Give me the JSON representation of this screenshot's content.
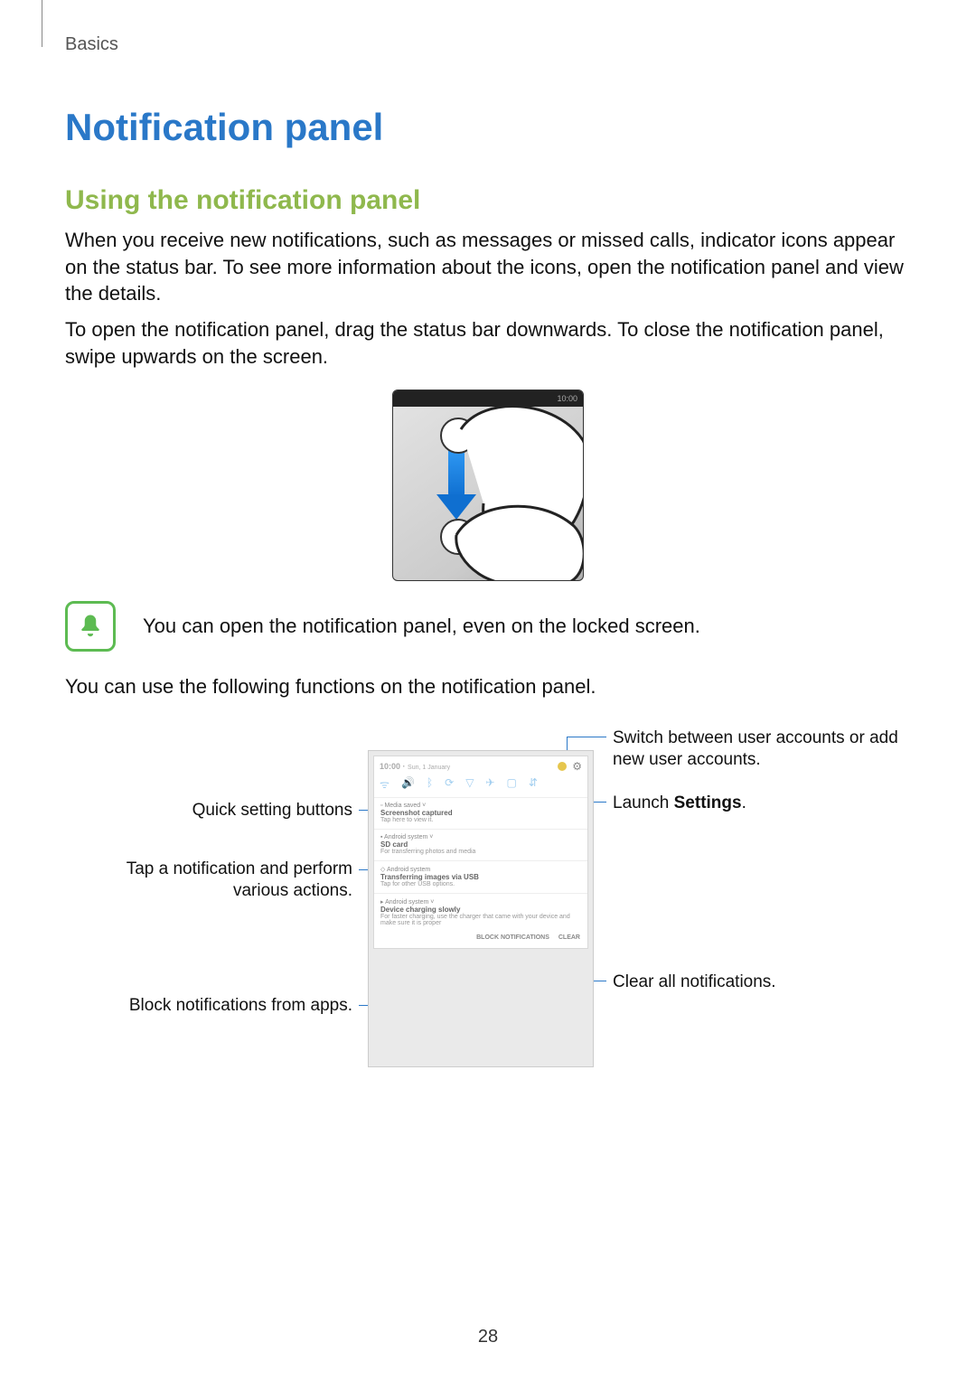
{
  "section": "Basics",
  "title": "Notification panel",
  "subtitle": "Using the notification panel",
  "para1": "When you receive new notifications, such as messages or missed calls, indicator icons appear on the status bar. To see more information about the icons, open the notification panel and view the details.",
  "para2": "To open the notification panel, drag the status bar downwards. To close the notification panel, swipe upwards on the screen.",
  "status_time": "10:00",
  "note_text": "You can open the notification panel, even on the locked screen.",
  "para3": "You can use the following functions on the notification panel.",
  "callouts": {
    "switch_users": "Switch between user accounts or add new user accounts.",
    "launch_settings_pre": "Launch ",
    "launch_settings_bold": "Settings",
    "launch_settings_post": ".",
    "quick_settings": "Quick setting buttons",
    "tap_notification": "Tap a notification and perform various actions.",
    "clear_all": "Clear all notifications.",
    "block_notifications": "Block notifications from apps."
  },
  "panel": {
    "time": "10:00",
    "date": "Sun, 1 January",
    "footer_block": "BLOCK NOTIFICATIONS",
    "footer_clear": "CLEAR",
    "n1_app": "Media saved",
    "n1_title": "Screenshot captured",
    "n1_sub": "Tap here to view it.",
    "n2_app": "Android system",
    "n2_title": "SD card",
    "n2_sub": "For transferring photos and media",
    "n3_app": "Android system",
    "n3_title": "Transferring images via USB",
    "n3_sub": "Tap for other USB options.",
    "n4_app": "Android system",
    "n4_title": "Device charging slowly",
    "n4_sub": "For faster charging, use the charger that came with your device and make sure it is proper"
  },
  "page_number": "28"
}
